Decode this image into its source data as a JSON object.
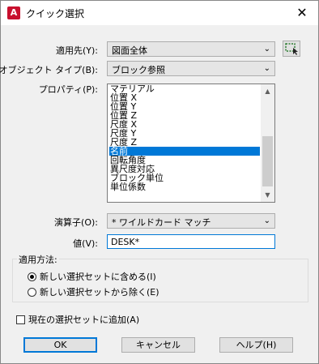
{
  "window": {
    "app_icon_letter": "A",
    "title": "クイック選択",
    "close_glyph": "✕"
  },
  "apply_to": {
    "label": "適用先(Y):",
    "value": "図面全体"
  },
  "object_type": {
    "label": "オブジェクト タイプ(B):",
    "value": "ブロック参照"
  },
  "properties": {
    "label": "プロパティ(P):",
    "items": [
      "マテリアル",
      "位置 X",
      "位置 Y",
      "位置 Z",
      "尺度 X",
      "尺度 Y",
      "尺度 Z",
      "名前",
      "回転角度",
      "異尺度対応",
      "ブロック単位",
      "単位係数"
    ],
    "selected": "名前"
  },
  "operator": {
    "label": "演算子(O):",
    "value": "* ワイルドカード マッチ"
  },
  "value_field": {
    "label": "値(V):",
    "value": "DESK*"
  },
  "apply_method": {
    "legend": "適用方法:",
    "include_label": "新しい選択セットに含める(I)",
    "exclude_label": "新しい選択セットから除く(E)",
    "selected": "include"
  },
  "append": {
    "label": "現在の選択セットに追加(A)",
    "checked": false
  },
  "buttons": {
    "ok": "OK",
    "cancel": "キャンセル",
    "help": "ヘルプ(H)"
  },
  "colors": {
    "accent": "#0078d7",
    "app_icon": "#c8102e"
  },
  "icons": {
    "dropdown": "chevron-down-icon",
    "select_objects": "select-objects-icon"
  }
}
